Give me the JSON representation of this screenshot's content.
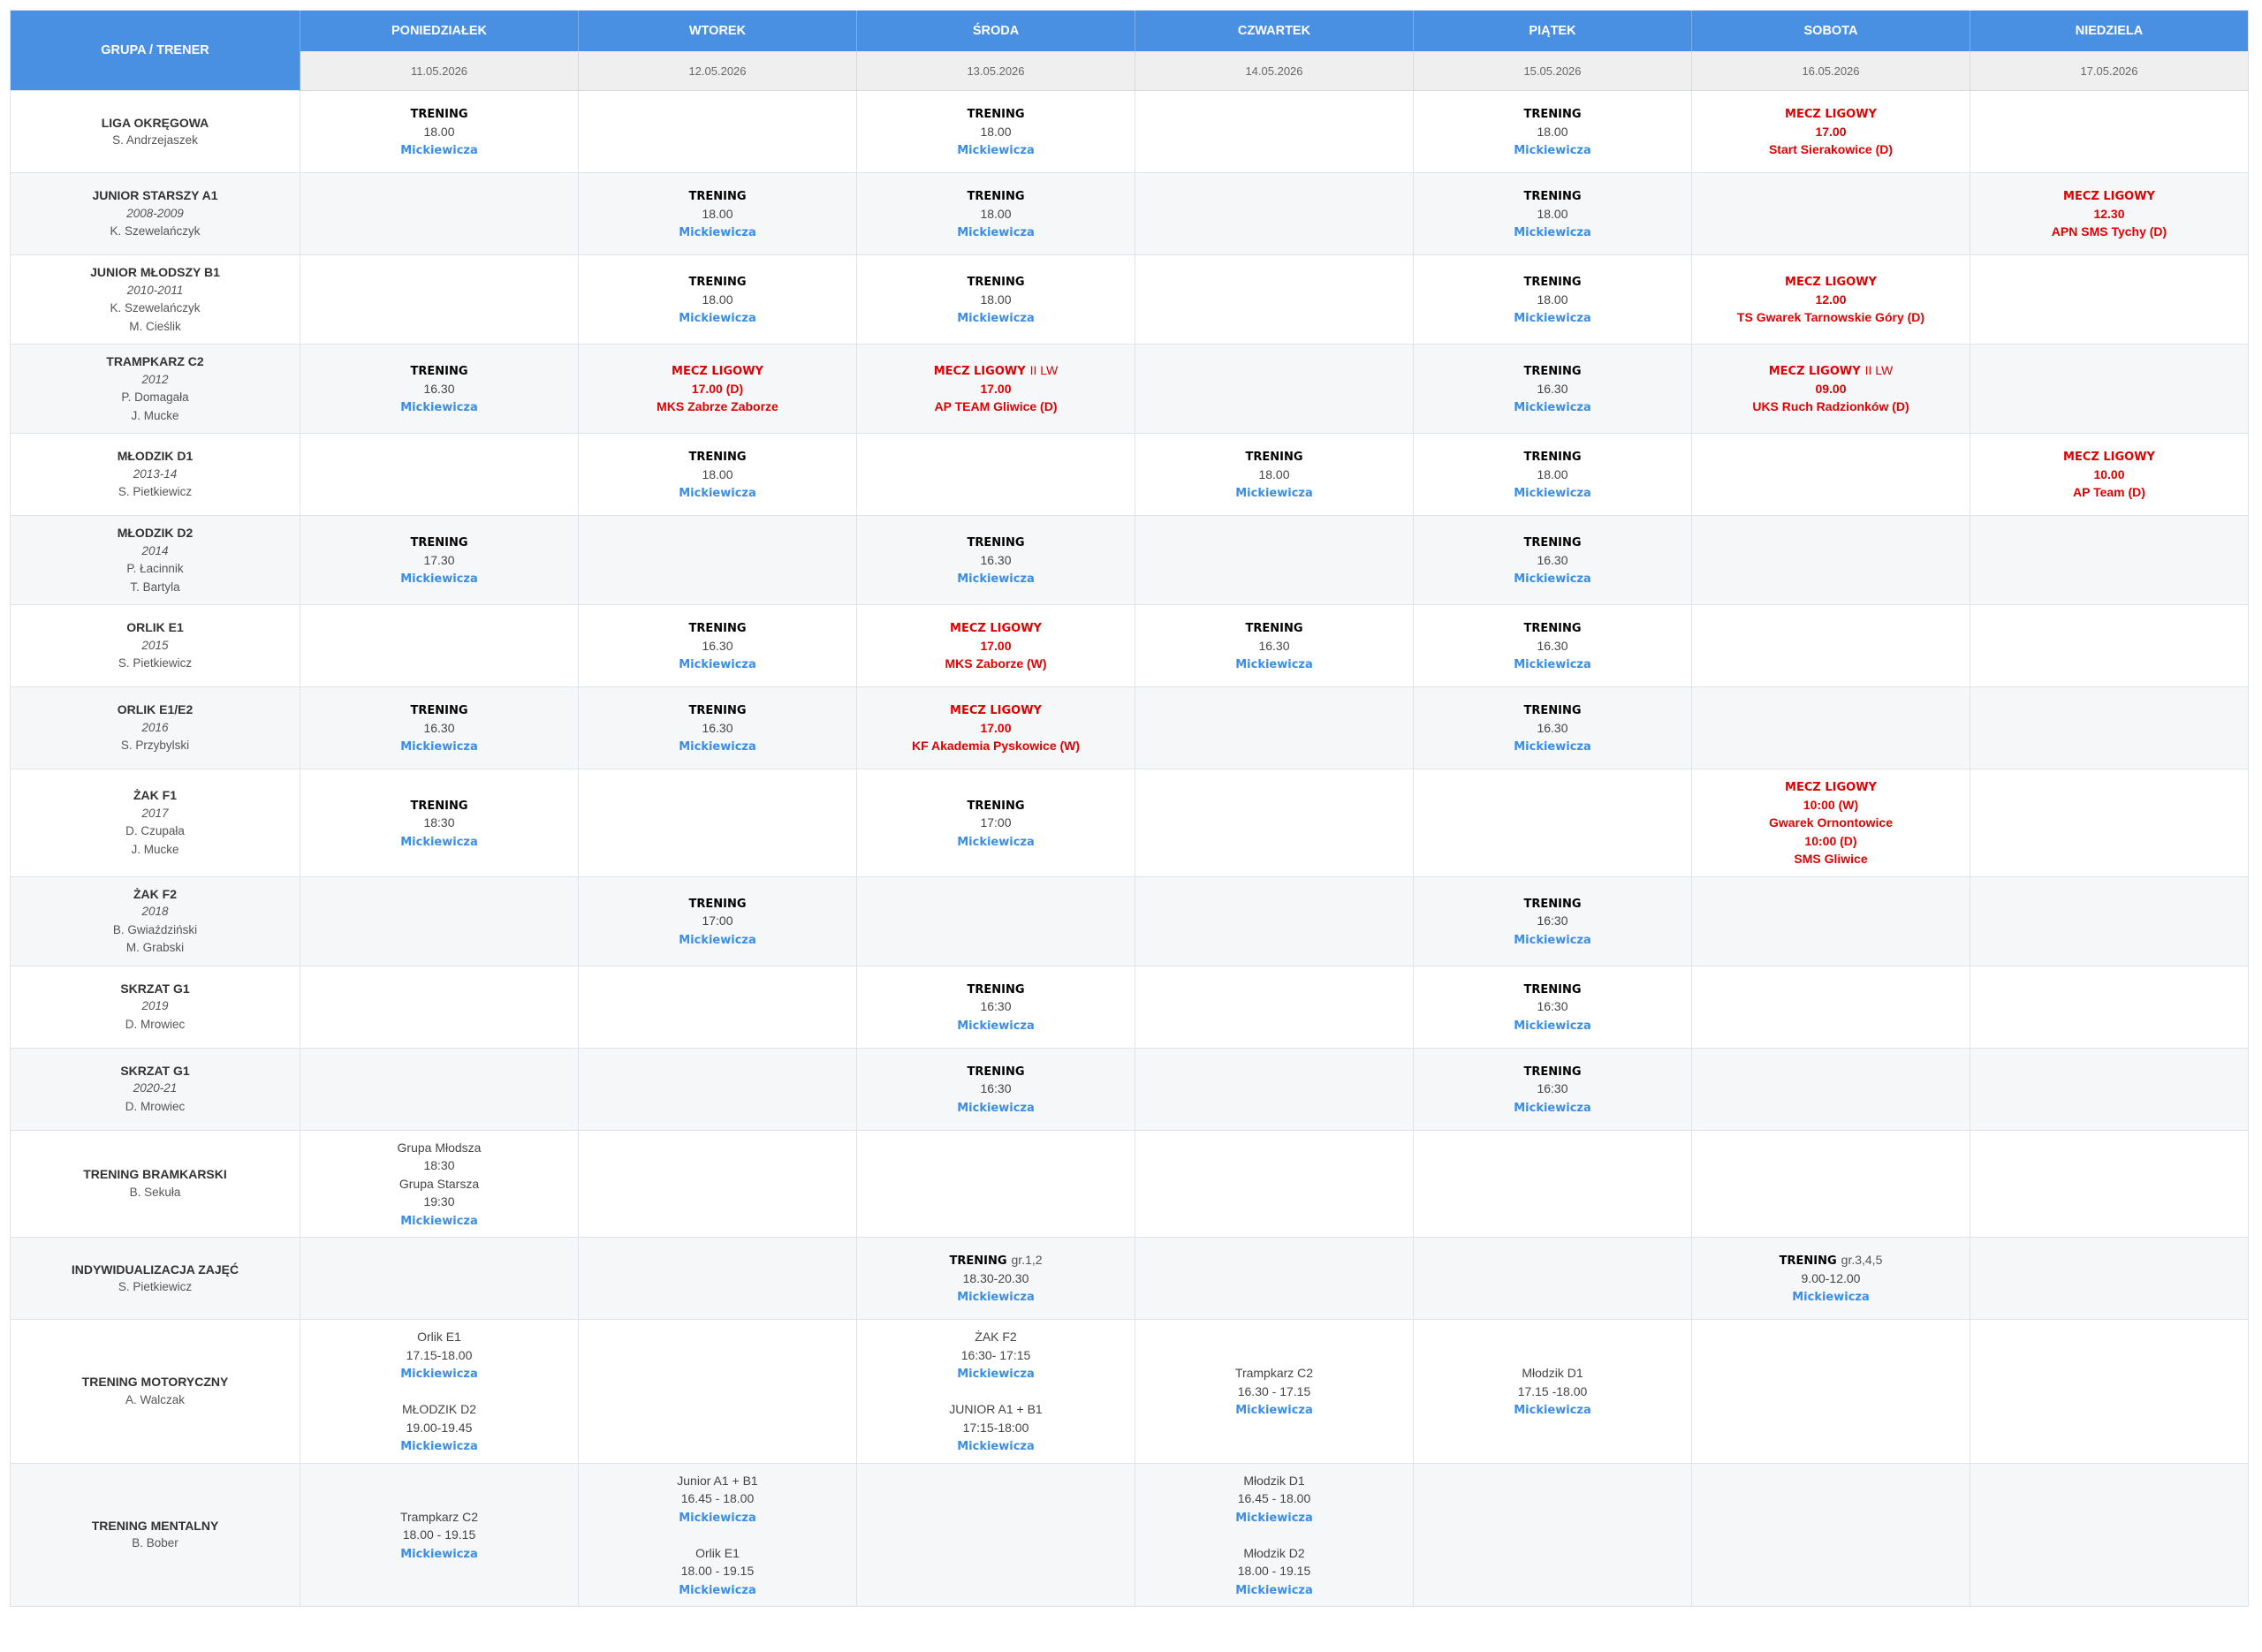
{
  "colors": {
    "header_bg": "#4a90e2",
    "date_row_bg": "#efefef",
    "row_alt_bg": "#f6f7f9",
    "training": "#000000",
    "location": "#3a8ee6",
    "match": "#e10000",
    "text": "#444444"
  },
  "header": {
    "group_label": "GRUPA / TRENER",
    "days": [
      {
        "name": "PONIEDZIAŁEK",
        "date": "11.05.2026"
      },
      {
        "name": "WTOREK",
        "date": "12.05.2026"
      },
      {
        "name": "ŚRODA",
        "date": "13.05.2026"
      },
      {
        "name": "CZWARTEK",
        "date": "14.05.2026"
      },
      {
        "name": "PIĄTEK",
        "date": "15.05.2026"
      },
      {
        "name": "SOBOTA",
        "date": "16.05.2026"
      },
      {
        "name": "NIEDZIELA",
        "date": "17.05.2026"
      }
    ]
  },
  "rows": [
    {
      "group": {
        "name": "LIGA OKRĘGOWA",
        "trainers": [
          "S. Andrzejaszek"
        ]
      },
      "cells": [
        [
          {
            "training": "TRENING"
          },
          {
            "time": "18.00"
          },
          {
            "place": "Mickiewicza"
          }
        ],
        [],
        [
          {
            "training": "TRENING"
          },
          {
            "time": "18.00"
          },
          {
            "place": "Mickiewicza"
          }
        ],
        [],
        [
          {
            "training": "TRENING"
          },
          {
            "time": "18.00"
          },
          {
            "place": "Mickiewicza"
          }
        ],
        [
          {
            "match": "MECZ LIGOWY"
          },
          {
            "match_time": "17.00"
          },
          {
            "opponent": "Start Sierakowice (D)"
          }
        ],
        []
      ]
    },
    {
      "group": {
        "name": "JUNIOR STARSZY A1",
        "years": "2008-2009",
        "trainers": [
          "K. Szewelańczyk"
        ]
      },
      "cells": [
        [],
        [
          {
            "training": "TRENING"
          },
          {
            "time": "18.00"
          },
          {
            "place": "Mickiewicza"
          }
        ],
        [
          {
            "training": "TRENING"
          },
          {
            "time": "18.00"
          },
          {
            "place": "Mickiewicza"
          }
        ],
        [],
        [
          {
            "training": "TRENING"
          },
          {
            "time": "18.00"
          },
          {
            "place": "Mickiewicza"
          }
        ],
        [],
        [
          {
            "match": "MECZ LIGOWY"
          },
          {
            "match_time": "12.30"
          },
          {
            "opponent": "APN SMS Tychy (D)"
          }
        ]
      ]
    },
    {
      "group": {
        "name": "JUNIOR MŁODSZY B1",
        "years": "2010-2011",
        "trainers": [
          "K. Szewelańczyk",
          "M. Cieślik"
        ]
      },
      "cells": [
        [],
        [
          {
            "training": "TRENING"
          },
          {
            "time": "18.00"
          },
          {
            "place": "Mickiewicza"
          }
        ],
        [
          {
            "training": "TRENING"
          },
          {
            "time": "18.00"
          },
          {
            "place": "Mickiewicza"
          }
        ],
        [],
        [
          {
            "training": "TRENING"
          },
          {
            "time": "18.00"
          },
          {
            "place": "Mickiewicza"
          }
        ],
        [
          {
            "match": "MECZ LIGOWY"
          },
          {
            "match_time": "12.00"
          },
          {
            "opponent": "TS Gwarek Tarnowskie Góry (D)"
          }
        ],
        []
      ]
    },
    {
      "group": {
        "name": "TRAMPKARZ C2",
        "years": "2012",
        "trainers": [
          "P. Domagała",
          "J. Mucke"
        ]
      },
      "cells": [
        [
          {
            "training": "TRENING"
          },
          {
            "time": "16.30"
          },
          {
            "place": "Mickiewicza"
          }
        ],
        [
          {
            "match": "MECZ LIGOWY"
          },
          {
            "match_time": "17.00 (D)"
          },
          {
            "opponent": "MKS Zabrze Zaborze"
          }
        ],
        [
          {
            "match": "MECZ LIGOWY",
            "note": "II LW"
          },
          {
            "match_time": "17.00"
          },
          {
            "opponent": "AP TEAM Gliwice (D)"
          }
        ],
        [],
        [
          {
            "training": "TRENING"
          },
          {
            "time": "16.30"
          },
          {
            "place": "Mickiewicza"
          }
        ],
        [
          {
            "match": "MECZ LIGOWY",
            "note": "II LW"
          },
          {
            "match_time": "09.00"
          },
          {
            "opponent": "UKS Ruch Radzionków (D)"
          }
        ],
        []
      ]
    },
    {
      "group": {
        "name": "MŁODZIK D1",
        "years": "2013-14",
        "trainers": [
          "S. Pietkiewicz"
        ]
      },
      "cells": [
        [],
        [
          {
            "training": "TRENING"
          },
          {
            "time": "18.00"
          },
          {
            "place": "Mickiewicza"
          }
        ],
        [],
        [
          {
            "training": "TRENING"
          },
          {
            "time": "18.00"
          },
          {
            "place": "Mickiewicza"
          }
        ],
        [
          {
            "training": "TRENING"
          },
          {
            "time": "18.00"
          },
          {
            "place": "Mickiewicza"
          }
        ],
        [],
        [
          {
            "match": "MECZ LIGOWY"
          },
          {
            "match_time": "10.00"
          },
          {
            "opponent": "AP Team (D)"
          }
        ]
      ]
    },
    {
      "group": {
        "name": "MŁODZIK D2",
        "years": "2014",
        "trainers": [
          "P. Łacinnik",
          "T. Bartyla"
        ]
      },
      "cells": [
        [
          {
            "training": "TRENING"
          },
          {
            "time": "17.30"
          },
          {
            "place": "Mickiewicza"
          }
        ],
        [],
        [
          {
            "training": "TRENING"
          },
          {
            "time": "16.30"
          },
          {
            "place": "Mickiewicza"
          }
        ],
        [],
        [
          {
            "training": "TRENING"
          },
          {
            "time": "16.30"
          },
          {
            "place": "Mickiewicza"
          }
        ],
        [],
        []
      ]
    },
    {
      "group": {
        "name": "ORLIK E1",
        "years": "2015",
        "trainers": [
          "S. Pietkiewicz"
        ]
      },
      "cells": [
        [],
        [
          {
            "training": "TRENING"
          },
          {
            "time": "16.30"
          },
          {
            "place": "Mickiewicza"
          }
        ],
        [
          {
            "match": "MECZ LIGOWY"
          },
          {
            "match_time": "17.00"
          },
          {
            "opponent": "MKS Zaborze (W)"
          }
        ],
        [
          {
            "training": "TRENING"
          },
          {
            "time": "16.30"
          },
          {
            "place": "Mickiewicza"
          }
        ],
        [
          {
            "training": "TRENING"
          },
          {
            "time": "16.30"
          },
          {
            "place": "Mickiewicza"
          }
        ],
        [],
        []
      ]
    },
    {
      "group": {
        "name": "ORLIK E1/E2",
        "years": "2016",
        "trainers": [
          "S. Przybylski"
        ]
      },
      "cells": [
        [
          {
            "training": "TRENING"
          },
          {
            "time": "16.30"
          },
          {
            "place": "Mickiewicza"
          }
        ],
        [
          {
            "training": "TRENING"
          },
          {
            "time": "16.30"
          },
          {
            "place": "Mickiewicza"
          }
        ],
        [
          {
            "match": "MECZ LIGOWY"
          },
          {
            "match_time": "17.00"
          },
          {
            "opponent": "KF Akademia Pyskowice (W)"
          }
        ],
        [],
        [
          {
            "training": "TRENING"
          },
          {
            "time": "16.30"
          },
          {
            "place": "Mickiewicza"
          }
        ],
        [],
        []
      ]
    },
    {
      "group": {
        "name": "ŻAK F1",
        "years": "2017",
        "trainers": [
          "D. Czupała",
          "J. Mucke"
        ]
      },
      "cells": [
        [
          {
            "training": "TRENING"
          },
          {
            "time": "18:30"
          },
          {
            "place": "Mickiewicza"
          }
        ],
        [],
        [
          {
            "training": "TRENING"
          },
          {
            "time": "17:00"
          },
          {
            "place": "Mickiewicza"
          }
        ],
        [],
        [],
        [
          {
            "match": "MECZ LIGOWY"
          },
          {
            "match_time": "10:00 (W)"
          },
          {
            "opponent": "Gwarek Ornontowice"
          },
          {
            "match_time": "10:00 (D)"
          },
          {
            "opponent": "SMS Gliwice"
          }
        ],
        []
      ]
    },
    {
      "group": {
        "name": "ŻAK F2",
        "years": "2018",
        "trainers": [
          "B. Gwiaździński",
          "M. Grabski"
        ]
      },
      "cells": [
        [],
        [
          {
            "training": "TRENING"
          },
          {
            "time": "17:00"
          },
          {
            "place": "Mickiewicza"
          }
        ],
        [],
        [],
        [
          {
            "training": "TRENING"
          },
          {
            "time": "16:30"
          },
          {
            "place": "Mickiewicza"
          }
        ],
        [],
        []
      ]
    },
    {
      "group": {
        "name": "SKRZAT G1",
        "years": "2019",
        "trainers": [
          "D. Mrowiec"
        ]
      },
      "cells": [
        [],
        [],
        [
          {
            "training": "TRENING"
          },
          {
            "time": "16:30"
          },
          {
            "place": "Mickiewicza"
          }
        ],
        [],
        [
          {
            "training": "TRENING"
          },
          {
            "time": "16:30"
          },
          {
            "place": "Mickiewicza"
          }
        ],
        [],
        []
      ]
    },
    {
      "group": {
        "name": "SKRZAT G1",
        "years": "2020-21",
        "trainers": [
          "D. Mrowiec"
        ]
      },
      "cells": [
        [],
        [],
        [
          {
            "training": "TRENING"
          },
          {
            "time": "16:30"
          },
          {
            "place": "Mickiewicza"
          }
        ],
        [],
        [
          {
            "training": "TRENING"
          },
          {
            "time": "16:30"
          },
          {
            "place": "Mickiewicza"
          }
        ],
        [],
        []
      ]
    },
    {
      "group": {
        "name": "TRENING BRAMKARSKI",
        "trainers": [
          "B. Sekuła"
        ]
      },
      "cells": [
        [
          {
            "text": "Grupa Młodsza"
          },
          {
            "time": "18:30"
          },
          {
            "text": "Grupa Starsza"
          },
          {
            "time": "19:30"
          },
          {
            "place": "Mickiewicza"
          }
        ],
        [],
        [],
        [],
        [],
        [],
        []
      ]
    },
    {
      "group": {
        "name": "INDYWIDUALIZACJA ZAJĘĆ",
        "trainers": [
          "S. Pietkiewicz"
        ]
      },
      "cells": [
        [],
        [],
        [
          {
            "training": "TRENING",
            "note": "gr.1,2"
          },
          {
            "time": "18.30-20.30"
          },
          {
            "place": "Mickiewicza"
          }
        ],
        [],
        [],
        [
          {
            "training": "TRENING",
            "note": "gr.3,4,5"
          },
          {
            "time": "9.00-12.00"
          },
          {
            "place": "Mickiewicza"
          }
        ],
        []
      ]
    },
    {
      "group": {
        "name": "TRENING MOTORYCZNY",
        "trainers": [
          "A. Walczak"
        ]
      },
      "cells": [
        [
          {
            "text": "Orlik E1"
          },
          {
            "time": "17.15-18.00"
          },
          {
            "place": "Mickiewicza"
          },
          {},
          {
            "text": "MŁODZIK D2"
          },
          {
            "time": "19.00-19.45"
          },
          {
            "place": "Mickiewicza"
          }
        ],
        [],
        [
          {
            "text": "ŻAK F2"
          },
          {
            "time": "16:30- 17:15"
          },
          {
            "place": "Mickiewicza"
          },
          {},
          {
            "text": "JUNIOR A1 + B1"
          },
          {
            "time": "17:15-18:00"
          },
          {
            "place": "Mickiewicza"
          }
        ],
        [
          {
            "text": "Trampkarz C2"
          },
          {
            "time": "16.30 - 17.15"
          },
          {
            "place": "Mickiewicza"
          }
        ],
        [
          {
            "text": "Młodzik D1"
          },
          {
            "time": "17.15 -18.00"
          },
          {
            "place": "Mickiewicza"
          }
        ],
        [],
        []
      ]
    },
    {
      "group": {
        "name": "TRENING MENTALNY",
        "trainers": [
          "B. Bober"
        ]
      },
      "cells": [
        [
          {
            "text": "Trampkarz C2"
          },
          {
            "time": "18.00 - 19.15"
          },
          {
            "place": "Mickiewicza"
          }
        ],
        [
          {
            "text": "Junior A1 + B1"
          },
          {
            "time": "16.45 - 18.00"
          },
          {
            "place": "Mickiewicza"
          },
          {},
          {
            "text": "Orlik E1"
          },
          {
            "time": "18.00 - 19.15"
          },
          {
            "place": "Mickiewicza"
          }
        ],
        [],
        [
          {
            "text": "Młodzik D1"
          },
          {
            "time": "16.45 - 18.00"
          },
          {
            "place": "Mickiewicza"
          },
          {},
          {
            "text": "Młodzik D2"
          },
          {
            "time": "18.00 - 19.15"
          },
          {
            "place": "Mickiewicza"
          }
        ],
        [],
        [],
        []
      ]
    }
  ]
}
